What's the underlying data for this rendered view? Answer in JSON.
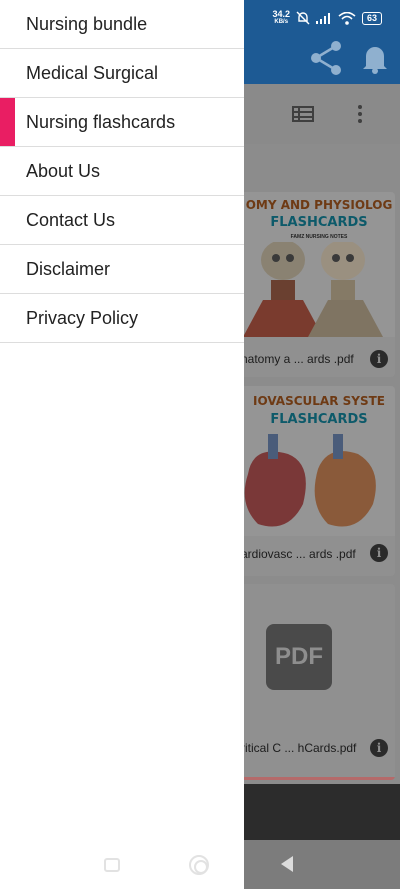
{
  "drawer": {
    "items": [
      {
        "label": "Nursing bundle",
        "active": false
      },
      {
        "label": "Medical Surgical",
        "active": false
      },
      {
        "label": "Nursing flashcards",
        "active": true
      },
      {
        "label": "About Us",
        "active": false
      },
      {
        "label": "Contact Us",
        "active": false
      },
      {
        "label": "Disclaimer",
        "active": false
      },
      {
        "label": "Privacy Policy",
        "active": false
      }
    ],
    "accent_color": "#e91e63"
  },
  "status_bar": {
    "speed_value": "34.2",
    "speed_unit": "KB/s",
    "battery": "63",
    "icons": [
      "mute-bell-icon",
      "signal-icon",
      "wifi-icon",
      "battery-icon"
    ]
  },
  "appbar": {
    "color": "#1d5a94",
    "actions": [
      "share-icon",
      "bell-icon"
    ]
  },
  "toolbar": {
    "actions": [
      "list-view-icon",
      "more-vert-icon"
    ]
  },
  "files": [
    {
      "title_line1": "OMY AND PHYSIOLOG",
      "title_line2": "FLASHCARDS",
      "subtitle": "FAMZ NURSING NOTES",
      "filename": "natomy a ... ards .pdf"
    },
    {
      "title_line1": "IOVASCULAR SYSTE",
      "title_line2": "FLASHCARDS",
      "filename": "ardiovasc ... ards .pdf"
    },
    {
      "badge": "PDF",
      "filename": "ritical C ... hCards.pdf"
    }
  ]
}
